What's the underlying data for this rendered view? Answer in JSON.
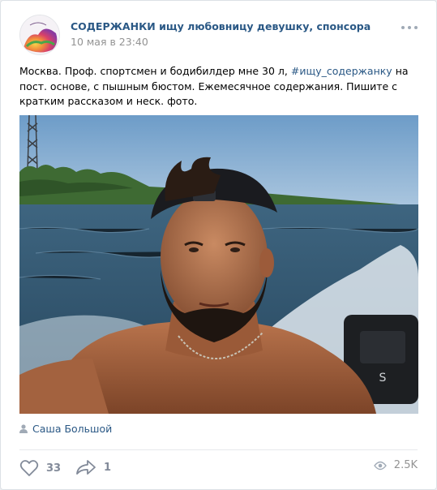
{
  "post": {
    "author": "СОДЕРЖАНКИ ищу любовницу девушку, спонсора",
    "date": "10 мая в 23:40",
    "text_before": "Москва. Проф. спортсмен и бодибилдер мне 30 л, ",
    "hashtag": "#ищу_содержанку",
    "text_after": " на пост. основе, с пышным бюстом. Ежемесячное содержания. Пишите с кратким рассказом и неск. фото.",
    "signer": "Саша Большой"
  },
  "stats": {
    "likes": "33",
    "shares": "1",
    "views": "2.5K"
  },
  "icons": {
    "menu": "more-dots-icon",
    "like": "heart-icon",
    "share": "share-arrow-icon",
    "views": "eye-icon",
    "signer": "user-icon"
  },
  "colors": {
    "link": "#2a5885",
    "muted": "#828a99",
    "date": "#939393",
    "icon": "#a0aab6"
  }
}
